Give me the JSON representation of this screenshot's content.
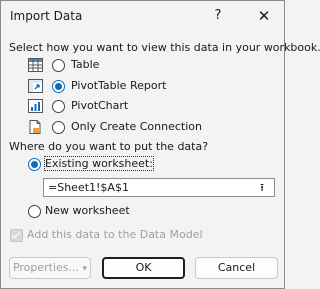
{
  "window": {
    "title": "Import Data",
    "help_glyph": "?",
    "close_glyph": "✕"
  },
  "view_section": {
    "heading": "Select how you want to view this data in your workbook.",
    "options": [
      {
        "label": "Table",
        "icon": "table-icon",
        "checked": false
      },
      {
        "label": "PivotTable Report",
        "icon": "pivottable-icon",
        "checked": true
      },
      {
        "label": "PivotChart",
        "icon": "pivotchart-icon",
        "checked": false
      },
      {
        "label": "Only Create Connection",
        "icon": "connection-icon",
        "checked": false
      }
    ]
  },
  "location_section": {
    "heading": "Where do you want to put the data?",
    "existing_label": "Existing worksheet:",
    "existing_checked": true,
    "range_value": "=Sheet1!$A$1",
    "collapse_glyph": "⭱",
    "new_label": "New worksheet",
    "new_checked": false
  },
  "data_model": {
    "label": "Add this data to the Data Model",
    "checked": true,
    "disabled": true
  },
  "buttons": {
    "properties": "Properties...",
    "properties_arrow": "▾",
    "ok": "OK",
    "cancel": "Cancel"
  },
  "colors": {
    "accent": "#0f6cbd",
    "background": "#f3f3f3",
    "disabled_text": "#a0a0a0"
  }
}
